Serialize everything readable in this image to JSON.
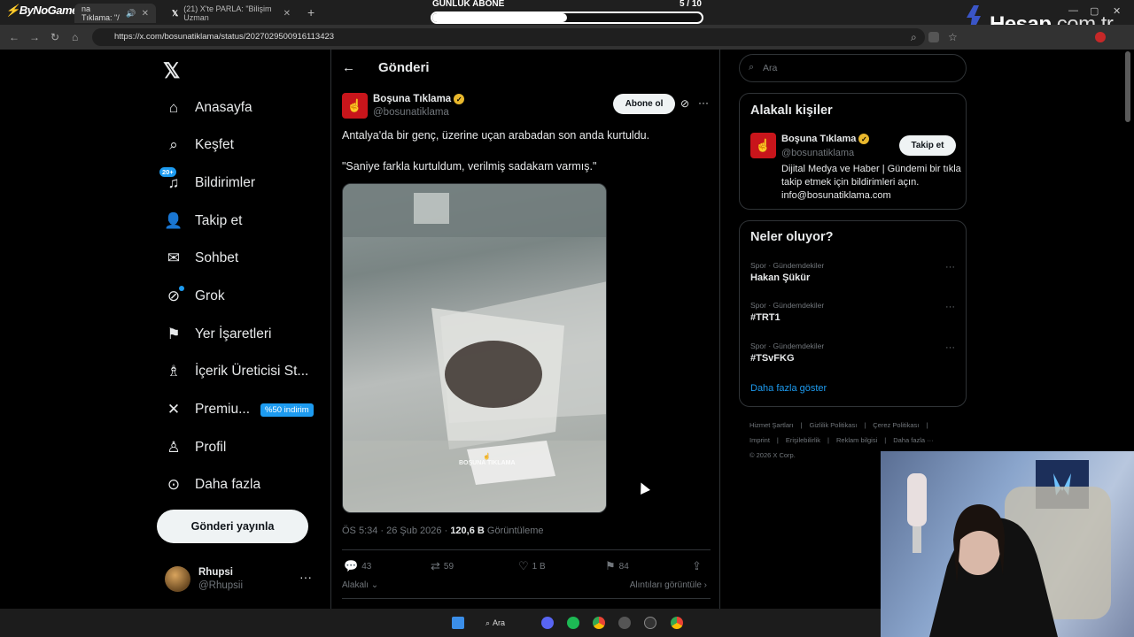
{
  "browser": {
    "tabs": [
      {
        "label": "na Tıklama: \"/"
      },
      {
        "label": "(21) X'te PARLA: \"Bilişim Uzman"
      }
    ],
    "url": "https://x.com/bosunatiklama/status/2027029500916113423"
  },
  "overlay": {
    "brand_left": "ByNoGame",
    "subscriber_title": "GÜNLÜK ABONE",
    "subscriber_count": "5   / 10",
    "subscriber_progress": 0.5,
    "hesap_brand": "Hesap",
    "hesap_suffix": ".com.tr"
  },
  "sidebar": {
    "items": [
      {
        "label": "Anasayfa",
        "icon": "home-icon"
      },
      {
        "label": "Keşfet",
        "icon": "search-icon"
      },
      {
        "label": "Bildirimler",
        "icon": "bell-icon",
        "badge": "20+"
      },
      {
        "label": "Takip et",
        "icon": "follow-icon"
      },
      {
        "label": "Sohbet",
        "icon": "mail-icon"
      },
      {
        "label": "Grok",
        "icon": "grok-icon"
      },
      {
        "label": "Yer İşaretleri",
        "icon": "bookmark-icon"
      },
      {
        "label": "İçerik Üreticisi St...",
        "icon": "creator-icon"
      },
      {
        "label": "Premiu...",
        "icon": "x-icon",
        "promo": "%50 indirim"
      },
      {
        "label": "Profil",
        "icon": "person-icon"
      },
      {
        "label": "Daha fazla",
        "icon": "more-circle-icon"
      }
    ],
    "post_button": "Gönderi yayınla",
    "profile": {
      "name": "Rhupsi",
      "handle": "@Rhupsii"
    }
  },
  "main": {
    "header_title": "Gönderi",
    "tweet": {
      "author_name": "Boşuna Tıklama",
      "author_handle": "@bosunatiklama",
      "follow_label": "Abone ol",
      "text1": "Antalya'da bir genç, üzerine uçan arabadan son anda kurtuldu.",
      "text2": "\"Saniye farkla kurtuldum, verilmiş sadakam varmış.\"",
      "watermark": "BOŞUNA TIKLAMA",
      "meta_time": "ÖS 5:34 · 26 Şub 2026 · ",
      "views": "120,6 B",
      "views_label": " Görüntüleme",
      "replies": "43",
      "retweets": "59",
      "likes": "1 B",
      "bookmarks": "84",
      "relevant": "Alakalı",
      "quotes": "Alıntıları görüntüle"
    }
  },
  "right": {
    "search_placeholder": "Ara",
    "relevant_title": "Alakalı kişiler",
    "relevant_person": {
      "name": "Boşuna Tıklama",
      "handle": "@bosunatiklama",
      "follow": "Takip et",
      "bio": "Dijital Medya ve Haber | Gündemi bir tıkla takip etmek için bildirimleri açın. info@bosunatiklama.com"
    },
    "trends_title": "Neler oluyor?",
    "trends": [
      {
        "meta": "Spor · Gündemdekiler",
        "name": "Hakan Şükür"
      },
      {
        "meta": "Spor · Gündemdekiler",
        "name": "#TRT1"
      },
      {
        "meta": "Spor · Gündemdekiler",
        "name": "#TSvFKG"
      }
    ],
    "show_more": "Daha fazla göster",
    "footer": [
      "Hizmet Şartları",
      "|",
      "Gizlilik Politikası",
      "|",
      "Çerez Politikası",
      "|",
      "Imprint",
      "|",
      "Erişilebilirlik",
      "|",
      "Reklam bilgisi",
      "|",
      "Daha fazla ···",
      "© 2026 X Corp."
    ]
  },
  "taskbar": {
    "search_label": "Ara"
  }
}
